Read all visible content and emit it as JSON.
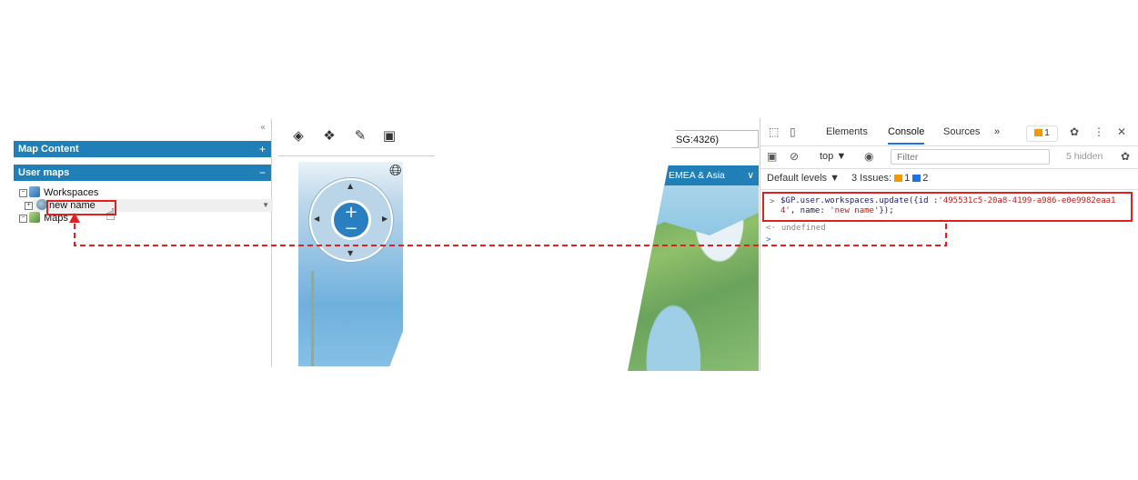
{
  "left_panel": {
    "collapse_icon": "«",
    "map_content_title": "Map Content",
    "map_content_toggle": "+",
    "user_maps_title": "User maps",
    "user_maps_toggle": "−",
    "tree": {
      "workspaces_label": "Workspaces",
      "item_label": "new name",
      "maps_label": "Maps"
    },
    "toolbar_icons": [
      "layers-icon",
      "layers-add-icon",
      "edit-pen-icon",
      "export-icon"
    ],
    "globe_icon": "globe-icon",
    "zoom_in": "+",
    "zoom_out": "−"
  },
  "right_panel": {
    "srs_label": "SG:4326)",
    "region_label": "EMEA & Asia",
    "devtools": {
      "tabs": [
        "Elements",
        "Console",
        "Sources",
        "»"
      ],
      "active_tab": "Console",
      "issues_badge": "1",
      "context": "top ▼",
      "filter_placeholder": "Filter",
      "hidden_count": "5 hidden",
      "default_levels": "Default levels ▼",
      "issues_summary": "3 Issues:",
      "issues_warn_count": "1",
      "issues_info_count": "2",
      "command_prefix": "$GP.user.workspaces.update({id :",
      "command_id": "'495531c5-20a8-4199-a986-e0e9982eaa14'",
      "command_mid": ", name: ",
      "command_name": "'new name'",
      "command_suffix": "});",
      "result": "undefined"
    }
  },
  "colors": {
    "panel_blue": "#1f7fb6",
    "highlight_red": "#e32020",
    "devtools_accent": "#1a73e8"
  }
}
